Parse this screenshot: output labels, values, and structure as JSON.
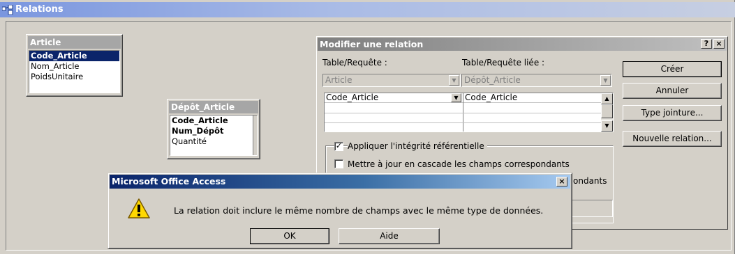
{
  "main_window": {
    "title": "Relations"
  },
  "tables": [
    {
      "title": "Article",
      "fields": [
        {
          "label": "Code_Article",
          "key": true,
          "selected": true
        },
        {
          "label": "Nom_Article",
          "key": false,
          "selected": false
        },
        {
          "label": "PoidsUnitaire",
          "key": false,
          "selected": false
        }
      ]
    },
    {
      "title": "Dépôt_Article",
      "fields": [
        {
          "label": "Code_Article",
          "key": true,
          "selected": false
        },
        {
          "label": "Num_Dépôt",
          "key": true,
          "selected": false
        },
        {
          "label": "Quantité",
          "key": false,
          "selected": false
        }
      ]
    }
  ],
  "edit_dialog": {
    "title": "Modifier une relation",
    "help_label": "?",
    "close_label": "×",
    "table_label": "Table/Requête :",
    "related_table_label": "Table/Requête liée :",
    "table_value": "Article",
    "related_table_value": "Dépôt_Article",
    "grid_row": {
      "left": "Code_Article",
      "right": "Code_Article"
    },
    "enforce_integrity": {
      "label": "Appliquer l'intégrité référentielle",
      "checked": true
    },
    "cascade_update": {
      "label": "Mettre à jour en cascade les champs correspondants",
      "checked": false
    },
    "cascade_delete_visible_fragment": "ondants",
    "buttons": {
      "create": "Créer",
      "cancel": "Annuler",
      "join_type": "Type jointure...",
      "new_relation": "Nouvelle relation..."
    }
  },
  "alert": {
    "title": "Microsoft Office Access",
    "close_label": "×",
    "message": "La relation doit inclure le même nombre de champs avec le même type de données.",
    "ok_label": "OK",
    "help_label": "Aide"
  }
}
